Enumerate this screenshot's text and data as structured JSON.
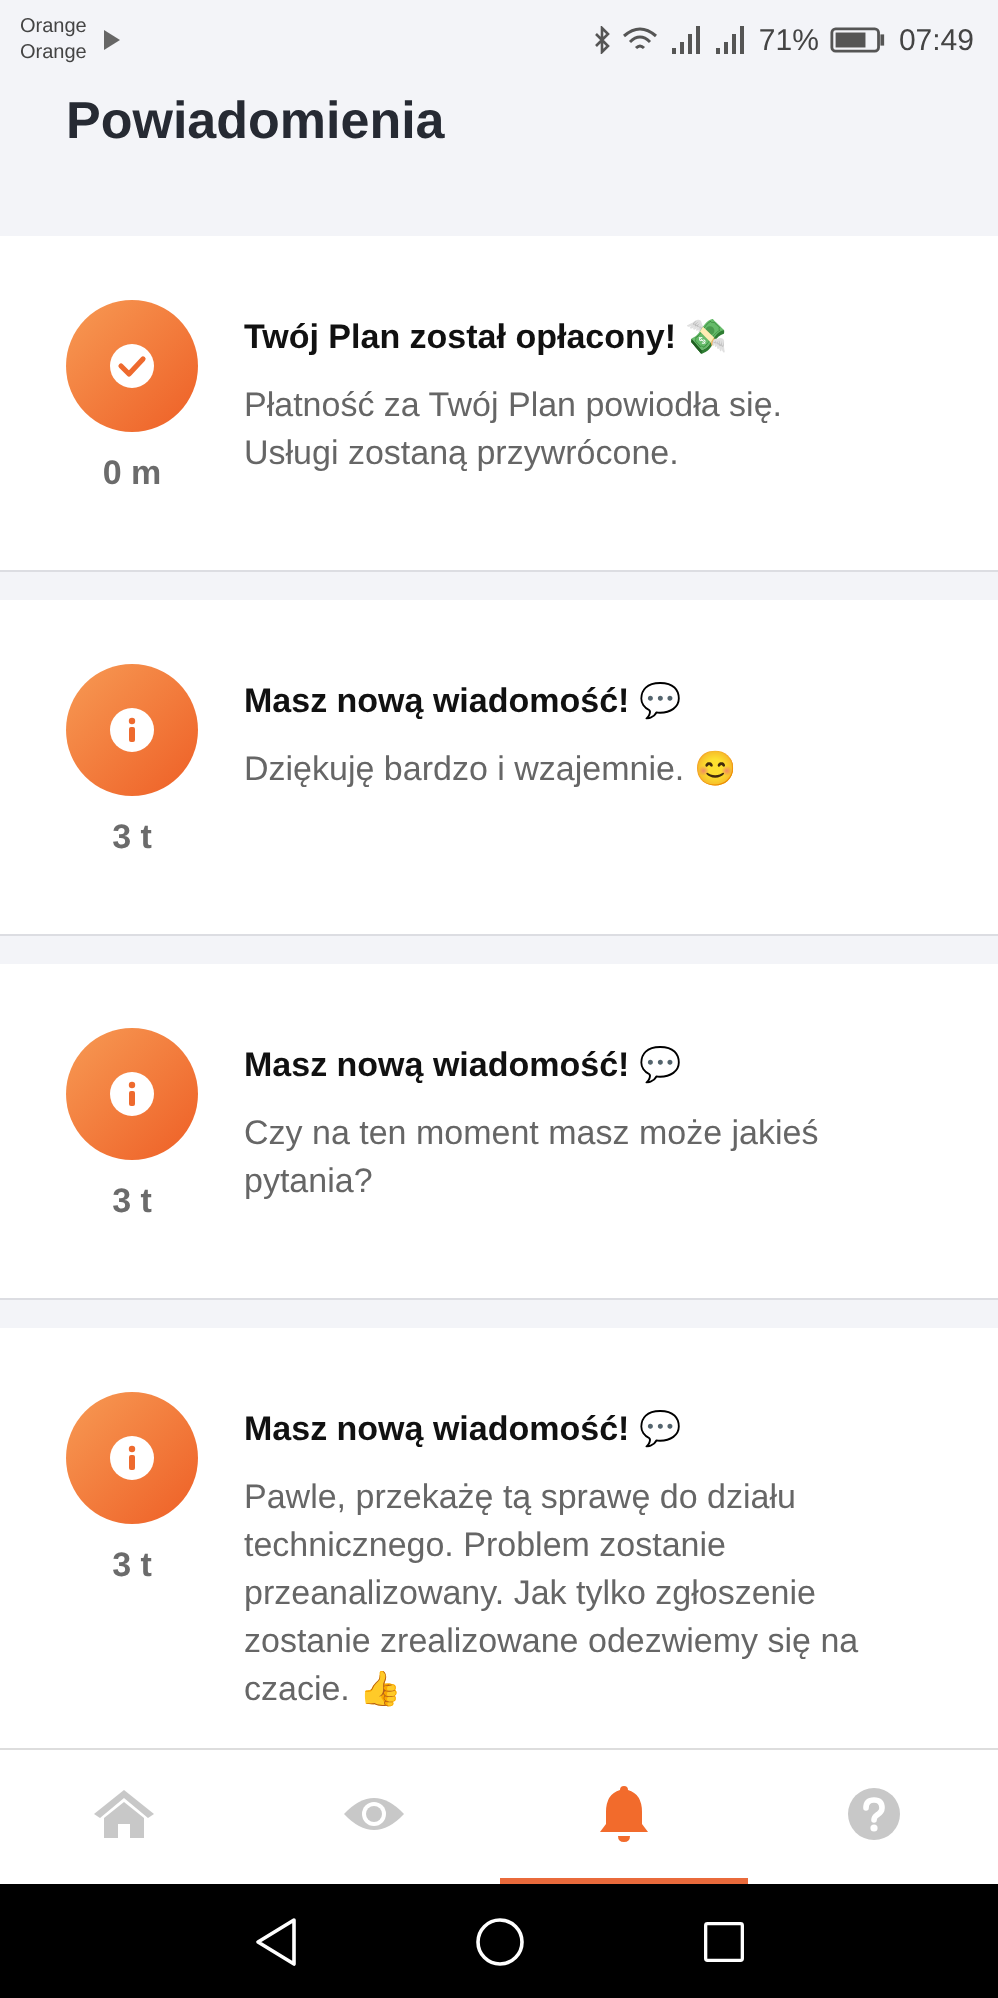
{
  "status_bar": {
    "carrier_lines": [
      "Orange",
      "Orange"
    ],
    "battery": "71%",
    "time": "07:49"
  },
  "title": "Powiadomienia",
  "notifications": [
    {
      "kind": "payment",
      "time": "0 m",
      "title": "Twój Plan został opłacony! 💸",
      "body": "Płatność za Twój Plan powiodła się. Usługi zostaną przywrócone."
    },
    {
      "kind": "message",
      "time": "3 t",
      "title": "Masz nową wiadomość! 💬",
      "body": "Dziękuję bardzo i wzajemnie. 😊"
    },
    {
      "kind": "message",
      "time": "3 t",
      "title": "Masz nową wiadomość! 💬",
      "body": "Czy na ten moment masz może jakieś pytania?"
    },
    {
      "kind": "message",
      "time": "3 t",
      "title": "Masz nową wiadomość! 💬",
      "body": "Pawle, przekażę tą sprawę do działu technicznego. Problem zostanie przeanalizowany. Jak tylko zgłoszenie zostanie zrealizowane odezwiemy się na czacie. 👍"
    }
  ],
  "bottom_nav": [
    {
      "kind": "home",
      "selected": false
    },
    {
      "kind": "eye",
      "selected": false
    },
    {
      "kind": "bell",
      "selected": true
    },
    {
      "kind": "help",
      "selected": false
    }
  ]
}
